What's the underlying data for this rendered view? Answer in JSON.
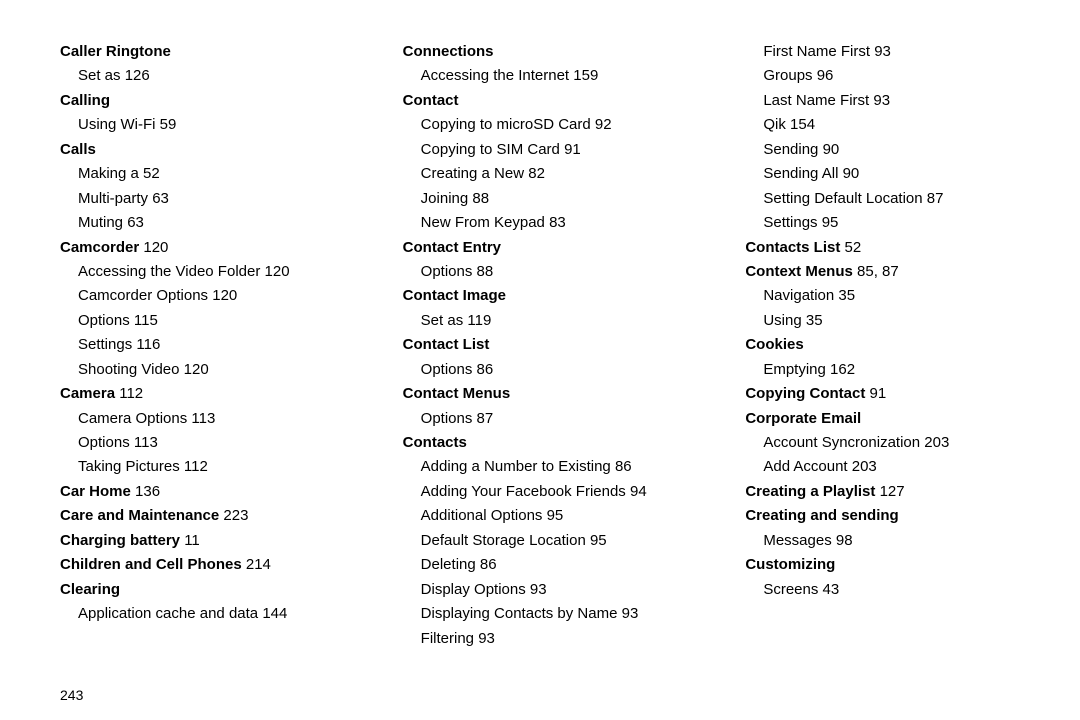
{
  "page_number": "243",
  "col1": [
    {
      "t": "h",
      "text": "Caller Ringtone"
    },
    {
      "t": "i",
      "text": "Set as",
      "p": "126"
    },
    {
      "t": "h",
      "text": "Calling"
    },
    {
      "t": "i",
      "text": "Using Wi-Fi",
      "p": "59"
    },
    {
      "t": "h",
      "text": "Calls"
    },
    {
      "t": "i",
      "text": "Making a",
      "p": "52"
    },
    {
      "t": "i",
      "text": "Multi-party",
      "p": "63"
    },
    {
      "t": "i",
      "text": "Muting",
      "p": "63"
    },
    {
      "t": "h",
      "text": "Camcorder",
      "p": "120"
    },
    {
      "t": "i",
      "text": "Accessing the Video Folder",
      "p": "120"
    },
    {
      "t": "i",
      "text": "Camcorder Options",
      "p": "120"
    },
    {
      "t": "i",
      "text": "Options",
      "p": "115"
    },
    {
      "t": "i",
      "text": "Settings",
      "p": "116"
    },
    {
      "t": "i",
      "text": "Shooting Video",
      "p": "120"
    },
    {
      "t": "h",
      "text": "Camera",
      "p": "112"
    },
    {
      "t": "i",
      "text": "Camera Options",
      "p": "113"
    },
    {
      "t": "i",
      "text": "Options",
      "p": "113"
    },
    {
      "t": "i",
      "text": "Taking Pictures",
      "p": "112"
    },
    {
      "t": "h",
      "text": "Car Home",
      "p": "136"
    },
    {
      "t": "h",
      "text": "Care and Maintenance",
      "p": "223"
    },
    {
      "t": "h",
      "text": "Charging battery",
      "p": "11"
    },
    {
      "t": "h",
      "text": "Children and Cell Phones",
      "p": "214"
    },
    {
      "t": "h",
      "text": "Clearing"
    },
    {
      "t": "i",
      "text": "Application cache and data",
      "p": "144"
    }
  ],
  "col2": [
    {
      "t": "h",
      "text": "Connections"
    },
    {
      "t": "i",
      "text": "Accessing the Internet",
      "p": "159"
    },
    {
      "t": "h",
      "text": "Contact"
    },
    {
      "t": "i",
      "text": "Copying to microSD Card",
      "p": "92"
    },
    {
      "t": "i",
      "text": "Copying to SIM Card",
      "p": "91"
    },
    {
      "t": "i",
      "text": "Creating a New",
      "p": "82"
    },
    {
      "t": "i",
      "text": "Joining",
      "p": "88"
    },
    {
      "t": "i",
      "text": "New From Keypad",
      "p": "83"
    },
    {
      "t": "h",
      "text": "Contact Entry"
    },
    {
      "t": "i",
      "text": "Options",
      "p": "88"
    },
    {
      "t": "h",
      "text": "Contact Image"
    },
    {
      "t": "i",
      "text": "Set as",
      "p": "119"
    },
    {
      "t": "h",
      "text": "Contact List"
    },
    {
      "t": "i",
      "text": "Options",
      "p": "86"
    },
    {
      "t": "h",
      "text": "Contact Menus"
    },
    {
      "t": "i",
      "text": "Options",
      "p": "87"
    },
    {
      "t": "h",
      "text": "Contacts"
    },
    {
      "t": "i",
      "text": "Adding a Number to Existing",
      "p": "86"
    },
    {
      "t": "i",
      "text": "Adding Your Facebook Friends",
      "p": "94"
    },
    {
      "t": "i",
      "text": "Additional Options",
      "p": "95"
    },
    {
      "t": "i",
      "text": "Default Storage Location",
      "p": "95"
    },
    {
      "t": "i",
      "text": "Deleting",
      "p": "86"
    },
    {
      "t": "i",
      "text": "Display Options",
      "p": "93"
    },
    {
      "t": "i",
      "text": "Displaying Contacts by Name",
      "p": "93"
    },
    {
      "t": "i",
      "text": "Filtering",
      "p": "93"
    }
  ],
  "col3": [
    {
      "t": "i",
      "text": "First Name First",
      "p": "93"
    },
    {
      "t": "i",
      "text": "Groups",
      "p": "96"
    },
    {
      "t": "i",
      "text": "Last Name First",
      "p": "93"
    },
    {
      "t": "i",
      "text": "Qik",
      "p": "154"
    },
    {
      "t": "i",
      "text": "Sending",
      "p": "90"
    },
    {
      "t": "i",
      "text": "Sending All",
      "p": "90"
    },
    {
      "t": "i",
      "text": "Setting Default Location",
      "p": "87"
    },
    {
      "t": "i",
      "text": "Settings",
      "p": "95"
    },
    {
      "t": "h",
      "text": "Contacts List",
      "p": "52"
    },
    {
      "t": "h",
      "text": "Context Menus",
      "p": "85, 87"
    },
    {
      "t": "i",
      "text": "Navigation",
      "p": "35"
    },
    {
      "t": "i",
      "text": "Using",
      "p": "35"
    },
    {
      "t": "h",
      "text": "Cookies"
    },
    {
      "t": "i",
      "text": "Emptying",
      "p": "162"
    },
    {
      "t": "h",
      "text": "Copying Contact",
      "p": "91"
    },
    {
      "t": "h",
      "text": "Corporate Email"
    },
    {
      "t": "i",
      "text": "Account Syncronization",
      "p": "203"
    },
    {
      "t": "i",
      "text": "Add Account",
      "p": "203"
    },
    {
      "t": "h",
      "text": "Creating a Playlist",
      "p": "127"
    },
    {
      "t": "h",
      "text": "Creating and sending"
    },
    {
      "t": "i",
      "text": "Messages",
      "p": "98"
    },
    {
      "t": "h",
      "text": "Customizing"
    },
    {
      "t": "i",
      "text": "Screens",
      "p": "43"
    }
  ]
}
